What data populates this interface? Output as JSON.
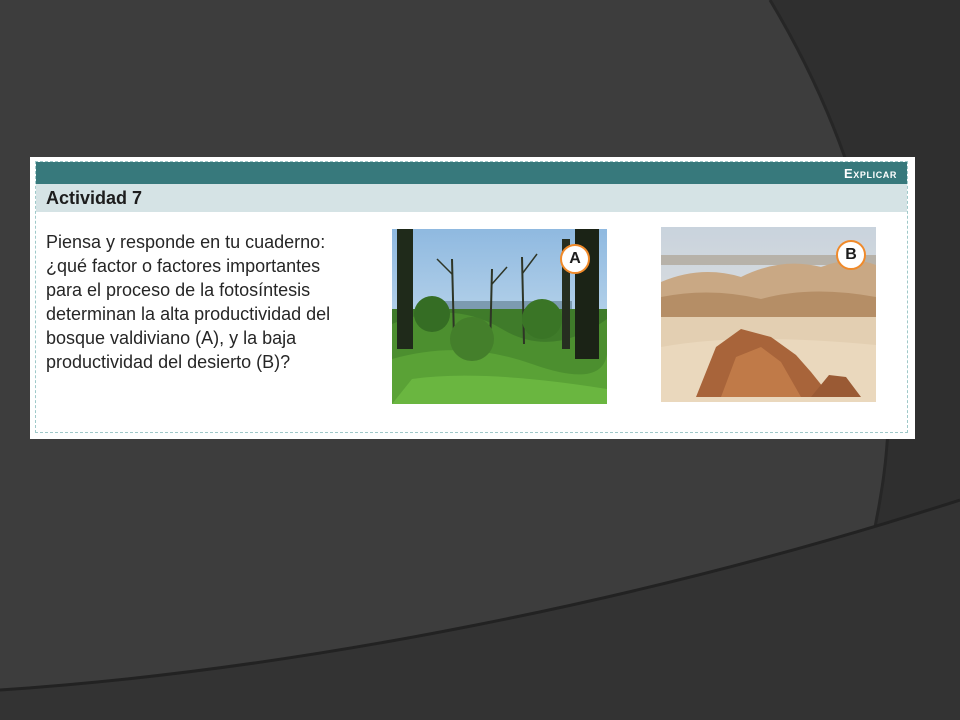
{
  "activity": {
    "section_label": "Explicar",
    "title": "Actividad 7",
    "question_lines": [
      "Piensa y responde en tu cuaderno:",
      "¿qué factor o factores importantes",
      "para el proceso de la fotosíntesis",
      "determinan la alta productividad del",
      "bosque valdiviano (A), y la baja",
      "productividad del desierto (B)?"
    ],
    "images": [
      {
        "badge": "A",
        "subject": "bosque valdiviano"
      },
      {
        "badge": "B",
        "subject": "desierto"
      }
    ]
  },
  "colors": {
    "slide_background": "#3d3d3d",
    "header_teal": "#37797c",
    "title_band": "#d5e3e5",
    "badge_ring": "#f08a2a"
  }
}
